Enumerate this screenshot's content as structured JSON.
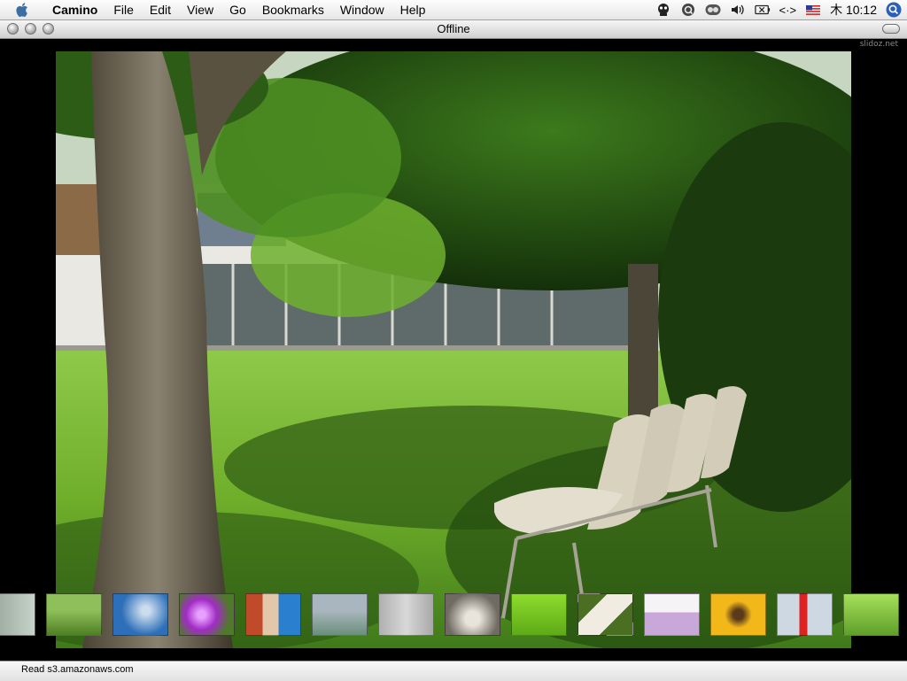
{
  "menubar": {
    "apple_icon": "apple-logo-icon",
    "items": [
      "Camino",
      "File",
      "Edit",
      "View",
      "Go",
      "Bookmarks",
      "Window",
      "Help"
    ],
    "tray": {
      "input_method_icon": "keyboard-brackets-icon",
      "input_method_label": "<·>",
      "flag_icon": "us-flag-icon",
      "clock": "木 10:12"
    }
  },
  "window": {
    "title": "Offline"
  },
  "content": {
    "watermark": "slidoz.net",
    "photo_description_icon": "park-bench-photo",
    "thumbnail_count": 14
  },
  "statusbar": {
    "text": "Read s3.amazonaws.com"
  },
  "colors": {
    "background": "#000000",
    "menubar": "#e6e6e6",
    "grass": "#6fae2a",
    "foliage": "#2f5e16"
  }
}
